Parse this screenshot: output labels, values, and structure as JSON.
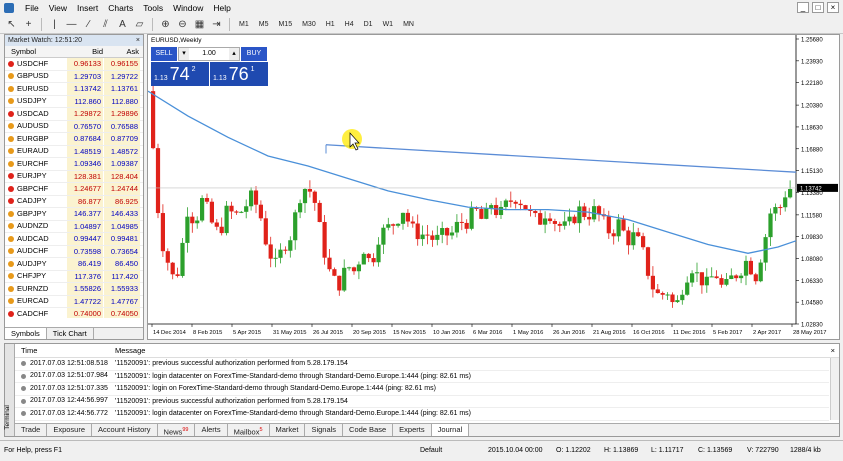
{
  "menu": [
    "File",
    "View",
    "Insert",
    "Charts",
    "Tools",
    "Window",
    "Help"
  ],
  "window_controls": [
    "_",
    "□",
    "×"
  ],
  "timeframes": [
    "M1",
    "M5",
    "M15",
    "M30",
    "H1",
    "H4",
    "D1",
    "W1",
    "MN"
  ],
  "market_watch": {
    "title": "Market Watch: 12:51:20",
    "close": "×",
    "headers": {
      "symbol": "Symbol",
      "bid": "Bid",
      "ask": "Ask"
    },
    "rows": [
      {
        "symbol": "USDCHF",
        "bid": "0.96133",
        "ask": "0.96155",
        "dir": "red"
      },
      {
        "symbol": "GBPUSD",
        "bid": "1.29703",
        "ask": "1.29722",
        "dir": "blue"
      },
      {
        "symbol": "EURUSD",
        "bid": "1.13742",
        "ask": "1.13761",
        "dir": "blue"
      },
      {
        "symbol": "USDJPY",
        "bid": "112.860",
        "ask": "112.880",
        "dir": "blue"
      },
      {
        "symbol": "USDCAD",
        "bid": "1.29872",
        "ask": "1.29896",
        "dir": "red"
      },
      {
        "symbol": "AUDUSD",
        "bid": "0.76570",
        "ask": "0.76588",
        "dir": "blue"
      },
      {
        "symbol": "EURGBP",
        "bid": "0.87684",
        "ask": "0.87709",
        "dir": "blue"
      },
      {
        "symbol": "EURAUD",
        "bid": "1.48519",
        "ask": "1.48572",
        "dir": "blue"
      },
      {
        "symbol": "EURCHF",
        "bid": "1.09346",
        "ask": "1.09387",
        "dir": "blue"
      },
      {
        "symbol": "EURJPY",
        "bid": "128.381",
        "ask": "128.404",
        "dir": "red"
      },
      {
        "symbol": "GBPCHF",
        "bid": "1.24677",
        "ask": "1.24744",
        "dir": "red"
      },
      {
        "symbol": "CADJPY",
        "bid": "86.877",
        "ask": "86.925",
        "dir": "red"
      },
      {
        "symbol": "GBPJPY",
        "bid": "146.377",
        "ask": "146.433",
        "dir": "blue"
      },
      {
        "symbol": "AUDNZD",
        "bid": "1.04897",
        "ask": "1.04985",
        "dir": "blue"
      },
      {
        "symbol": "AUDCAD",
        "bid": "0.99447",
        "ask": "0.99481",
        "dir": "blue"
      },
      {
        "symbol": "AUDCHF",
        "bid": "0.73598",
        "ask": "0.73654",
        "dir": "blue"
      },
      {
        "symbol": "AUDJPY",
        "bid": "86.419",
        "ask": "86.450",
        "dir": "blue"
      },
      {
        "symbol": "CHFJPY",
        "bid": "117.376",
        "ask": "117.420",
        "dir": "blue"
      },
      {
        "symbol": "EURNZD",
        "bid": "1.55826",
        "ask": "1.55933",
        "dir": "blue"
      },
      {
        "symbol": "EURCAD",
        "bid": "1.47722",
        "ask": "1.47767",
        "dir": "blue"
      },
      {
        "symbol": "CADCHF",
        "bid": "0.74000",
        "ask": "0.74050",
        "dir": "red"
      }
    ],
    "tabs": [
      "Symbols",
      "Tick Chart"
    ]
  },
  "chart": {
    "label": "EURUSD,Weekly",
    "one_click": {
      "sell_label": "SELL",
      "buy_label": "BUY",
      "lot": "1.00",
      "sell_prefix": "1.13",
      "sell_big": "74",
      "sell_sup": "2",
      "buy_prefix": "1.13",
      "buy_big": "76",
      "buy_sup": "1"
    },
    "current_price": "1.13742",
    "price_labels": [
      "1.25680",
      "1.23930",
      "1.22180",
      "1.20380",
      "1.18630",
      "1.16880",
      "1.15130",
      "1.13380",
      "1.11580",
      "1.09830",
      "1.08080",
      "1.06330",
      "1.04580",
      "1.02830"
    ],
    "time_labels": [
      "14 Dec 2014",
      "8 Feb 2015",
      "5 Apr 2015",
      "31 May 2015",
      "26 Jul 2015",
      "20 Sep 2015",
      "15 Nov 2015",
      "10 Jan 2016",
      "6 Mar 2016",
      "1 May 2016",
      "26 Jun 2016",
      "21 Aug 2016",
      "16 Oct 2016",
      "11 Dec 2016",
      "5 Feb 2017",
      "2 Apr 2017",
      "28 May 2017"
    ],
    "colors": {
      "bull": "#2ca02c",
      "bear": "#e0221a",
      "ma": "#4a90d9",
      "trend": "#5b8cd6",
      "price_tag": "#000000"
    }
  },
  "terminal": {
    "side_label": "Terminal",
    "close": "×",
    "headers": {
      "time": "Time",
      "message": "Message"
    },
    "rows": [
      {
        "time": "2017.07.03 12:51:08.518",
        "message": "'11520091': previous successful authorization performed from 5.28.179.154"
      },
      {
        "time": "2017.07.03 12:51:07.984",
        "message": "'11520091': login datacenter on ForexTime-Standard-demo through Standard-Demo.Europe.1:444 (ping: 82.61 ms)"
      },
      {
        "time": "2017.07.03 12:51:07.335",
        "message": "'11520091': login on ForexTime-Standard-demo through Standard-Demo.Europe.1:444 (ping: 82.61 ms)"
      },
      {
        "time": "2017.07.03 12:44:56.997",
        "message": "'11520091': previous successful authorization performed from 5.28.179.154"
      },
      {
        "time": "2017.07.03 12:44:56.772",
        "message": "'11520091': login datacenter on ForexTime-Standard-demo through Standard-Demo.Europe.1:444 (ping: 82.61 ms)"
      }
    ],
    "tabs": [
      {
        "label": "Trade",
        "badge": ""
      },
      {
        "label": "Exposure",
        "badge": ""
      },
      {
        "label": "Account History",
        "badge": ""
      },
      {
        "label": "News",
        "badge": "99"
      },
      {
        "label": "Alerts",
        "badge": ""
      },
      {
        "label": "Mailbox",
        "badge": "5"
      },
      {
        "label": "Market",
        "badge": ""
      },
      {
        "label": "Signals",
        "badge": ""
      },
      {
        "label": "Code Base",
        "badge": ""
      },
      {
        "label": "Experts",
        "badge": ""
      },
      {
        "label": "Journal",
        "badge": ""
      }
    ],
    "active_tab": "Journal"
  },
  "status": {
    "help": "For Help, press F1",
    "profile": "Default",
    "datetime": "2015.10.04 00:00",
    "open": "O: 1.12202",
    "high": "H: 1.13869",
    "low": "L: 1.11717",
    "close": "C: 1.13569",
    "volume": "V: 722790",
    "traffic": "1288/4 kb"
  }
}
